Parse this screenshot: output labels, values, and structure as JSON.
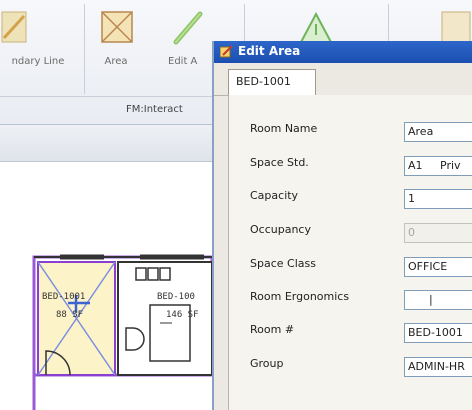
{
  "ribbon": {
    "buttons": [
      {
        "label": "ndary Line",
        "icon": "boundary-line-icon"
      },
      {
        "label": "Area",
        "icon": "area-icon"
      },
      {
        "label": "Edit A",
        "icon": "edit-area-pencil-icon"
      },
      {
        "label": "",
        "icon": "warning-triangle-icon"
      },
      {
        "label": "",
        "icon": "office-icon"
      }
    ],
    "group_label": "FM:Interact"
  },
  "floorplan": {
    "rooms": [
      {
        "name": "BED-1001",
        "area": "88 SF"
      },
      {
        "name": "BED-100",
        "area": "146 SF"
      }
    ]
  },
  "dialog": {
    "title": "Edit Area",
    "tab": "BED-1001",
    "fields": [
      {
        "label": "Room Name",
        "value": "Area",
        "disabled": false
      },
      {
        "label": "Space Std.",
        "value": "A1     Priv",
        "disabled": false
      },
      {
        "label": "Capacity",
        "value": "1",
        "disabled": false
      },
      {
        "label": "Occupancy",
        "value": "0",
        "disabled": true
      },
      {
        "label": "Space Class",
        "value": "OFFICE",
        "disabled": false
      },
      {
        "label": "Room Ergonomics",
        "value": "      |",
        "disabled": false
      },
      {
        "label": "Room #",
        "value": "BED-1001",
        "disabled": false
      },
      {
        "label": "Group",
        "value": "ADMIN-HR",
        "disabled": false
      }
    ]
  },
  "colors": {
    "titlebar": "#1a4fb0",
    "selected_room_fill": "#fdf3c8",
    "room_outline": "#8a3fd1",
    "selection_marker": "#3b63d6"
  }
}
